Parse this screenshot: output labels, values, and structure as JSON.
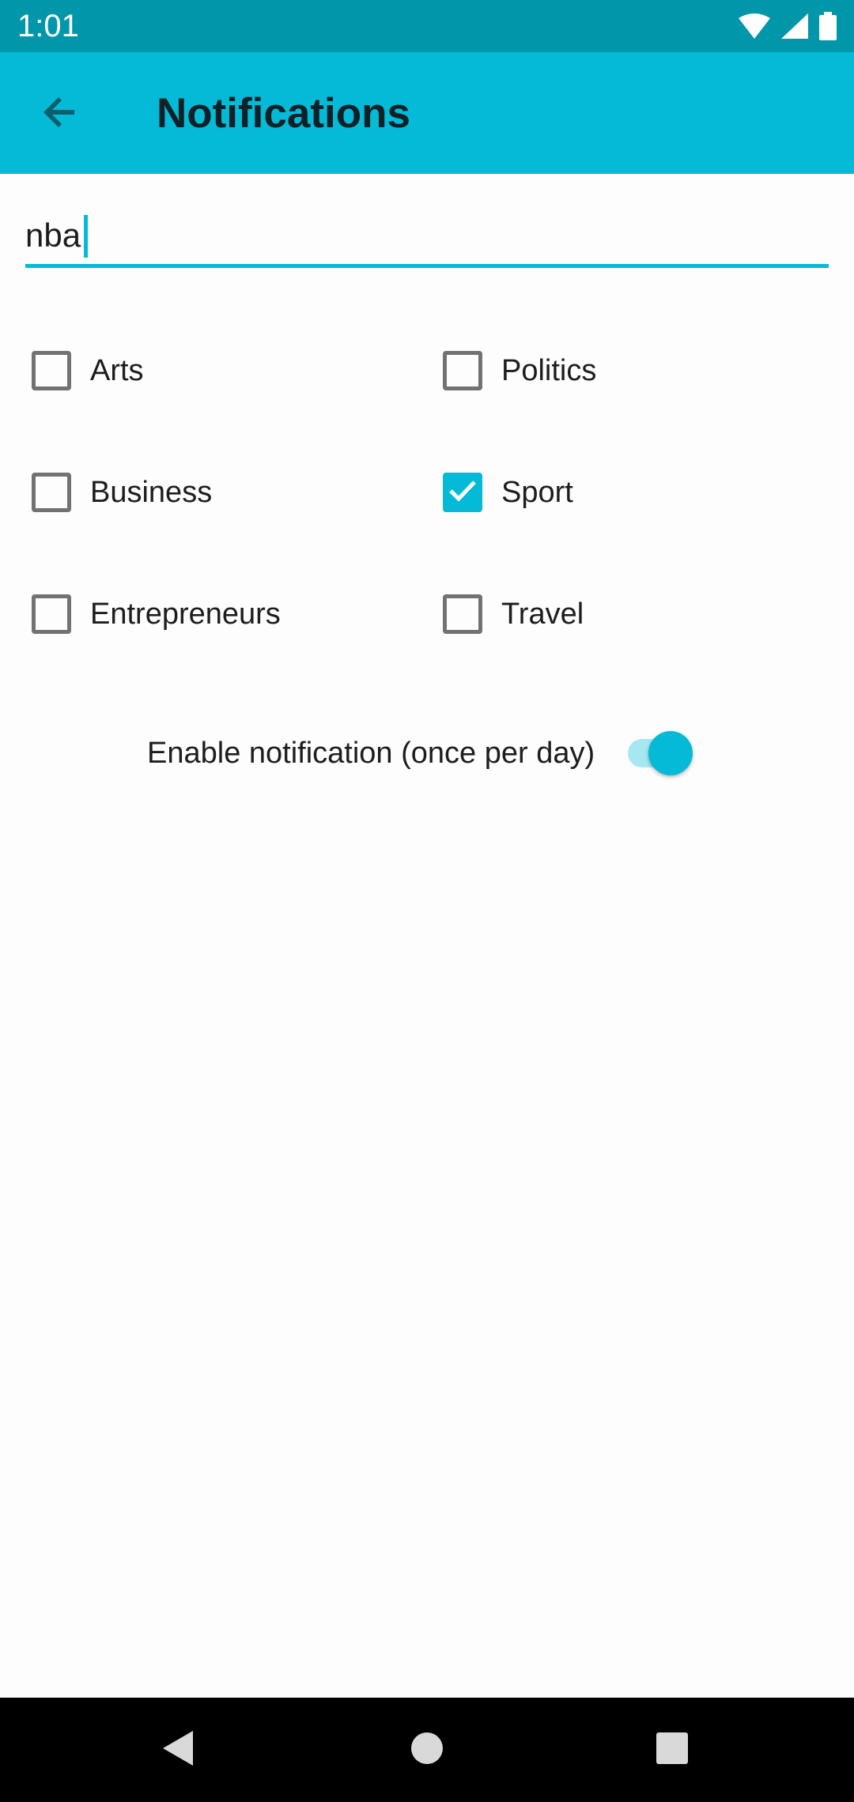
{
  "status_bar": {
    "time": "1:01",
    "icons": [
      "wifi-icon",
      "signal-icon",
      "battery-icon"
    ]
  },
  "app_bar": {
    "back_icon": "arrow-back-icon",
    "title": "Notifications"
  },
  "search": {
    "value": "nba"
  },
  "categories": [
    {
      "label": "Arts",
      "checked": false
    },
    {
      "label": "Politics",
      "checked": false
    },
    {
      "label": "Business",
      "checked": false
    },
    {
      "label": "Sport",
      "checked": true
    },
    {
      "label": "Entrepreneurs",
      "checked": false
    },
    {
      "label": "Travel",
      "checked": false
    }
  ],
  "notification_toggle": {
    "label": "Enable notification (once per day)",
    "enabled": true
  },
  "nav_bar": {
    "icons": [
      "back-triangle-icon",
      "home-circle-icon",
      "recents-square-icon"
    ]
  },
  "colors": {
    "status_bar": "#0296ab",
    "accent": "#04bad6",
    "title_text": "#102027"
  }
}
